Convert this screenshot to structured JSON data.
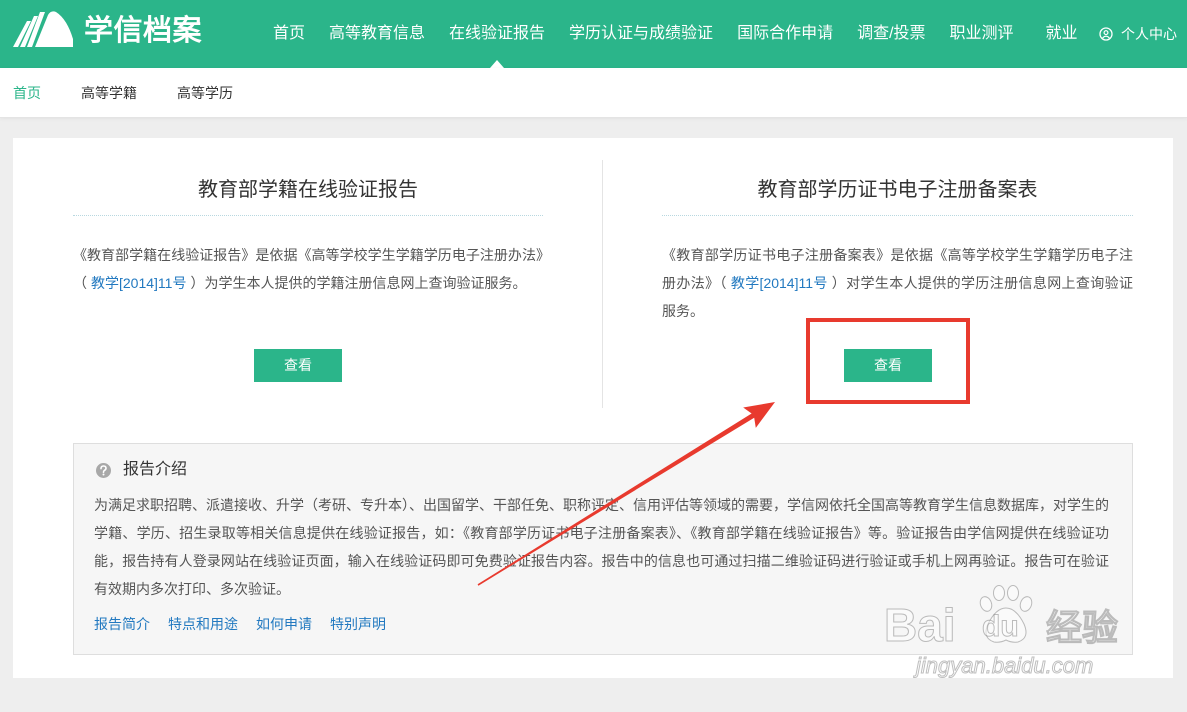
{
  "colors": {
    "brand": "#2bb58a",
    "link": "#2279c0",
    "annotation": "#e83a2e"
  },
  "header": {
    "logo_icon": "book-wing-logo-icon",
    "logo_text": "学信档案",
    "nav": [
      {
        "label": "首页",
        "active": false
      },
      {
        "label": "高等教育信息",
        "active": false
      },
      {
        "label": "在线验证报告",
        "active": true
      },
      {
        "label": "学历认证与成绩验证",
        "active": false
      },
      {
        "label": "国际合作申请",
        "active": false
      },
      {
        "label": "调查/投票",
        "active": false
      },
      {
        "label": "职业测评",
        "active": false
      },
      {
        "label": "就业",
        "active": false
      }
    ],
    "user_menu": {
      "icon": "user-circle-icon",
      "label": "个人中心"
    }
  },
  "subnav": {
    "items": [
      {
        "label": "首页",
        "active": true
      },
      {
        "label": "高等学籍",
        "active": false
      },
      {
        "label": "高等学历",
        "active": false
      }
    ]
  },
  "reports": [
    {
      "title": "教育部学籍在线验证报告",
      "desc_prefix": "《教育部学籍在线验证报告》是依据《高等学校学生学籍学历电子注册办法》（",
      "desc_link": "教学[2014]11号",
      "desc_suffix": "）为学生本人提供的学籍注册信息网上查询验证服务。",
      "button_label": "查看"
    },
    {
      "title": "教育部学历证书电子注册备案表",
      "desc_prefix": "《教育部学历证书电子注册备案表》是依据《高等学校学生学籍学历电子注册办法》（",
      "desc_link": "教学[2014]11号",
      "desc_suffix": "）对学生本人提供的学历注册信息网上查询验证服务。",
      "button_label": "查看"
    }
  ],
  "intro": {
    "icon": "question-circle-icon",
    "title": "报告介绍",
    "body": "为满足求职招聘、派遣接收、升学（考研、专升本）、出国留学、干部任免、职称评定、信用评估等领域的需要，学信网依托全国高等教育学生信息数据库，对学生的学籍、学历、招生录取等相关信息提供在线验证报告，如：《教育部学历证书电子注册备案表》、《教育部学籍在线验证报告》等。验证报告由学信网提供在线验证功能，报告持有人登录网站在线验证页面，输入在线验证码即可免费验证报告内容。报告中的信息也可通过扫描二维验证码进行验证或手机上网再验证。报告可在验证有效期内多次打印、多次验证。",
    "links": [
      {
        "label": "报告简介"
      },
      {
        "label": "特点和用途"
      },
      {
        "label": "如何申请"
      },
      {
        "label": "特别声明"
      }
    ]
  },
  "watermark": {
    "brand_left": "Bai",
    "brand_right": "du",
    "product": "经验",
    "url": "jingyan.baidu.com",
    "icon": "paw-icon"
  }
}
